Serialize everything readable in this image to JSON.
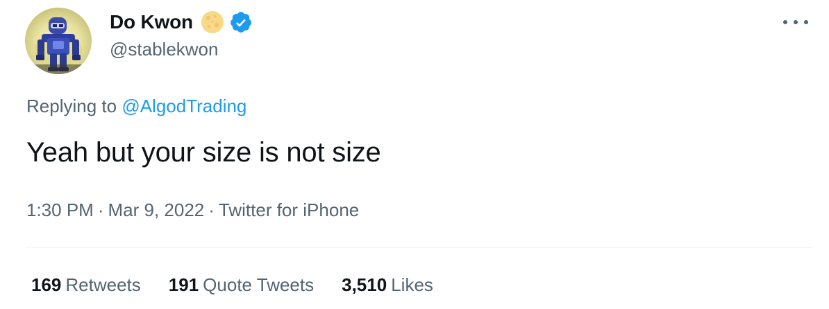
{
  "author": {
    "display_name": "Do Kwon",
    "handle": "@stablekwon",
    "avatar_icon": "robot-avatar",
    "badges": [
      "moon-icon",
      "verified-icon"
    ]
  },
  "reply": {
    "prefix": "Replying to",
    "mention": "@AlgodTrading"
  },
  "tweet": {
    "text": "Yeah but your size is not size",
    "time": "1:30 PM",
    "date": "Mar 9, 2022",
    "source": "Twitter for iPhone",
    "separator": "·"
  },
  "stats": {
    "retweets": {
      "count": "169",
      "label": "Retweets"
    },
    "quotes": {
      "count": "191",
      "label": "Quote Tweets"
    },
    "likes": {
      "count": "3,510",
      "label": "Likes"
    }
  },
  "colors": {
    "text": "#0f1419",
    "secondary": "#536471",
    "link": "#1d9bf0",
    "verified": "#1d9bf0",
    "divider": "#eff3f4"
  }
}
